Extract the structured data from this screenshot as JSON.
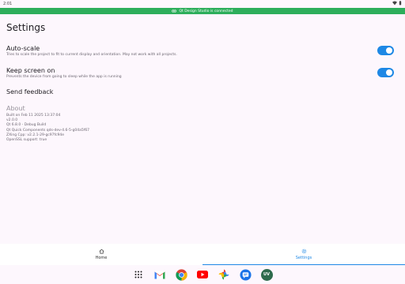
{
  "statusbar": {
    "time": "2:01"
  },
  "banner": {
    "text": "Qt Design Studio is connected"
  },
  "page": {
    "title": "Settings"
  },
  "settings": [
    {
      "label": "Auto-scale",
      "description": "Tries to scale the project to fit to current display and orientation. May not work with all projects.",
      "enabled": true
    },
    {
      "label": "Keep screen on",
      "description": "Prevents the device from going to sleep while the app is running",
      "enabled": true
    }
  ],
  "feedback": {
    "label": "Send feedback"
  },
  "about": {
    "heading": "About",
    "lines": [
      "Built on Feb 11 2025 13:37:04",
      "v2.0.0",
      "Qt 6.8.0 - Debug Build",
      "Qt Quick Components qds-dev-4.6-5-g04a5f67",
      "ZXing Cpp: v2.2.1-29-gc97fc94e",
      "OpenSSL support: true"
    ]
  },
  "nav": {
    "home_label": "Home",
    "settings_label": "Settings",
    "active": "Settings",
    "accent": "#1e88e5"
  },
  "dock": {
    "apps": [
      "app-drawer-icon",
      "gmail-icon",
      "chrome-icon",
      "youtube-icon",
      "photos-icon",
      "messages-icon",
      "qt-viewer-icon"
    ],
    "qt_viewer_label": "UV"
  },
  "colors": {
    "banner": "#2dae5b",
    "toggle": "#1e88e5"
  }
}
